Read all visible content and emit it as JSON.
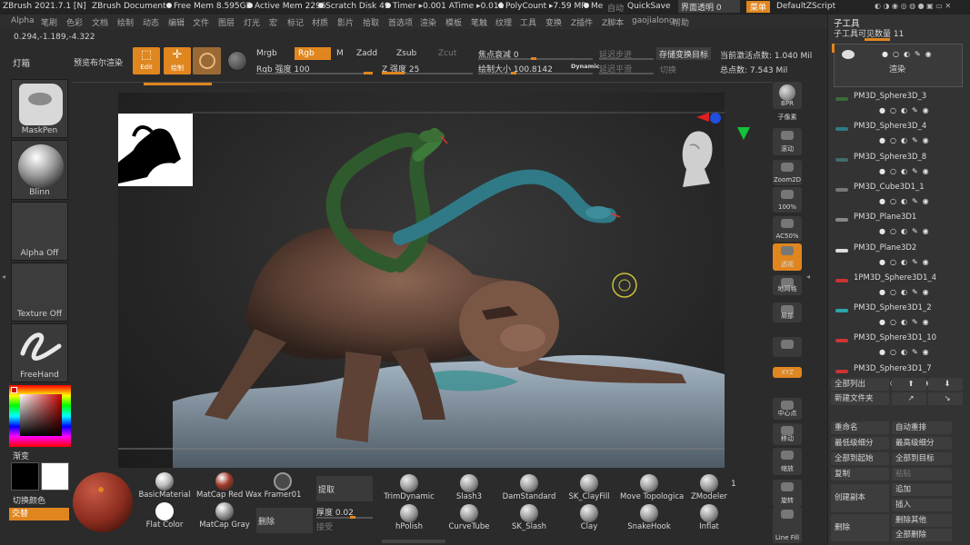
{
  "titlebar": {
    "app": "ZBrush 2021.7.1 [N]",
    "doc": "ZBrush Document",
    "free_mem": "Free Mem 8.595GB",
    "active_mem": "Active Mem 2296",
    "scratch": "Scratch Disk 49",
    "timer": "Timer ▸0.001 ATime ▸0.011",
    "polycount": "PolyCount ▸7.59 MP",
    "me": "Me",
    "auto": "自动",
    "quicksave": "QuickSave",
    "transparency": "界面透明 0",
    "menu_btn": "菜单",
    "script": "DefaultZScript"
  },
  "menu": [
    "Alpha",
    "笔刷",
    "色彩",
    "文档",
    "绘制",
    "动态",
    "编辑",
    "文件",
    "图层",
    "灯光",
    "宏",
    "标记",
    "材质",
    "影片",
    "拾取",
    "首选项",
    "渲染",
    "模板",
    "笔触",
    "纹理",
    "工具",
    "变换",
    "Z插件",
    "Z脚本",
    "gaojialong",
    "帮助"
  ],
  "coords": "0.294,-1.189,-4.322",
  "toolbar": {
    "lightbox": "灯箱",
    "bpr": "预览布尔渲染",
    "edit": "Edit",
    "draw": "绘制",
    "mrgb": "Mrgb",
    "rgb": "Rgb",
    "m": "M",
    "zadd": "Zadd",
    "zsub": "Zsub",
    "zcut": "Zcut",
    "rgb_intensity": "Rgb 强度 100",
    "z_intensity": "Z 强度 25",
    "focal_shift": "焦点衰减 0",
    "draw_size": "绘制大小 100.8142",
    "dynamic": "Dynamic",
    "lazy_step": "延迟步进",
    "lazy_smooth": "延迟平滑",
    "store_morph": "存储变换目标",
    "switch": "切换",
    "active_points": "当前激活点数: 1.040 Mil",
    "total_points": "总点数: 7.543 Mil"
  },
  "left_shelf": {
    "maskpen": "MaskPen",
    "blinn": "Blinn",
    "alpha_off": "Alpha Off",
    "texture_off": "Texture Off",
    "freehand": "FreeHand",
    "gradient": "渐变",
    "switch_color": "切换颜色",
    "alternate": "交替"
  },
  "right_shelf": [
    {
      "icon": "bpr-icon",
      "label": "BPR"
    },
    {
      "icon": "subpixel-icon",
      "label": "子像素"
    },
    {
      "icon": "scroll-icon",
      "label": "滚动"
    },
    {
      "icon": "zoom2d-icon",
      "label": "Zoom2D"
    },
    {
      "icon": "actual-icon",
      "label": "100%"
    },
    {
      "icon": "ac50-icon",
      "label": "AC50%"
    },
    {
      "icon": "perspective-icon",
      "label": "透视"
    },
    {
      "icon": "floor-icon",
      "label": "地网格"
    },
    {
      "icon": "local-icon",
      "label": "局部"
    },
    {
      "icon": "lock-icon",
      "label": ""
    },
    {
      "icon": "xyz-icon",
      "label": "XYZ"
    },
    {
      "icon": "frame-icon",
      "label": "中心点"
    },
    {
      "icon": "move-icon",
      "label": "移动"
    },
    {
      "icon": "scale-icon",
      "label": "缩放"
    },
    {
      "icon": "rotate-icon",
      "label": "旋转"
    },
    {
      "icon": "linefill-icon",
      "label": "Line Fill"
    }
  ],
  "subtool": {
    "title": "子工具",
    "visible_count": "子工具可见数量 11",
    "render": "渲染",
    "items": [
      "PM3D_Sphere3D_3",
      "PM3D_Sphere3D_4",
      "PM3D_Sphere3D_8",
      "PM3D_Cube3D1_1",
      "PM3D_Plane3D1",
      "PM3D_Plane3D2",
      "1PM3D_Sphere3D1_4",
      "PM3D_Sphere3D1_2",
      "PM3D_Sphere3D1_10",
      "PM3D_Sphere3D1_7"
    ],
    "list_all": "全部列出",
    "new_folder": "新建文件夹",
    "rename": "重命名",
    "auto_reorder": "自动重排",
    "lowest_subdiv": "最低级细分",
    "highest_subdiv": "最高级细分",
    "all_to_start": "全部到起始",
    "all_to_target": "全部到目标",
    "copy": "复制",
    "paste": "粘贴",
    "create_copy": "创建副本",
    "append": "追加",
    "insert": "插入",
    "delete": "删除",
    "delete_other": "删除其他",
    "delete_all": "全部删除"
  },
  "bottom": {
    "materials": [
      {
        "label": "BasicMaterial",
        "color": "#bdbdbd"
      },
      {
        "label": "MatCap Red Wax",
        "color": "#a03a2a"
      },
      {
        "label": "Framer01",
        "color": "#4a4a4a"
      },
      {
        "label": "Flat Color",
        "color": "#ffffff"
      },
      {
        "label": "MatCap Gray",
        "color": "#9a9a9a"
      }
    ],
    "pick": "提取",
    "delete": "删除",
    "thickness": "厚度 0.02",
    "accept": "接受",
    "brushes": [
      {
        "label": "TrimDynamic"
      },
      {
        "label": "Slash3"
      },
      {
        "label": "DamStandard"
      },
      {
        "label": "SK_ClayFill"
      },
      {
        "label": "Move Topologica"
      },
      {
        "label": "ZModeler"
      },
      {
        "label": "hPolish"
      },
      {
        "label": "CurveTube"
      },
      {
        "label": "SK_Slash"
      },
      {
        "label": "Clay"
      },
      {
        "label": "SnakeHook"
      },
      {
        "label": "Inflat"
      }
    ],
    "page": "1"
  },
  "colors": {
    "accent": "#e0861f",
    "bg": "#2b2b2b",
    "panel": "#333333"
  }
}
